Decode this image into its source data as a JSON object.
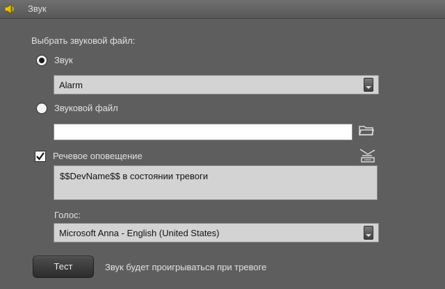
{
  "window": {
    "title": "Звук"
  },
  "section_label": "Выбрать звуковой файл:",
  "sound_option": {
    "label": "Звук",
    "selected": true
  },
  "sound_select": {
    "value": "Alarm"
  },
  "file_option": {
    "label": "Звуковой файл",
    "selected": false
  },
  "file_input": {
    "value": ""
  },
  "speech": {
    "label": "Речевое оповещение",
    "checked": true,
    "text": "$$DevName$$ в состоянии тревоги"
  },
  "voice": {
    "label": "Голос:",
    "value": "Microsoft Anna - English (United States)"
  },
  "test_button": {
    "label": "Тест"
  },
  "status_text": "Звук будет проигрываться при тревоге",
  "icons": {
    "title": "speaker-icon",
    "browse": "folder-open-icon",
    "speech": "speech-icon",
    "dropdown": "chevron-down-icon"
  }
}
